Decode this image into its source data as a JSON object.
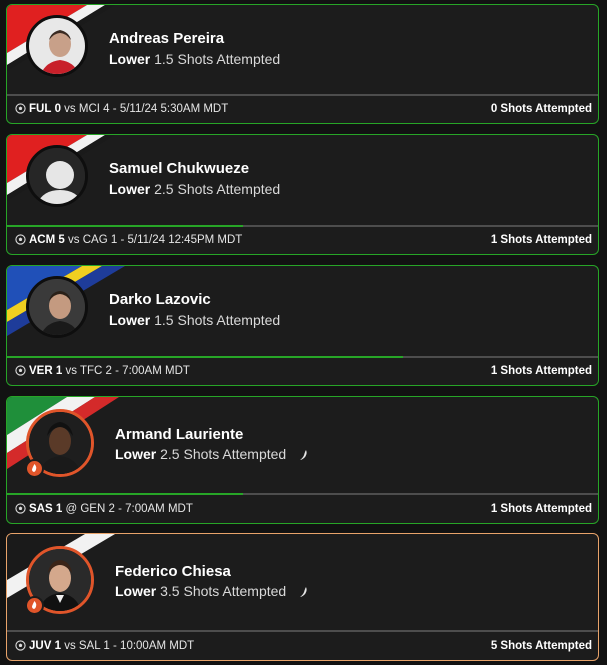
{
  "cards": [
    {
      "name": "Andreas Pereira",
      "direction": "Lower",
      "line": "1.5",
      "stat": "Shots Attempted",
      "team1": "FUL",
      "score1": "0",
      "sep": "vs",
      "team2": "MCI",
      "score2": "4",
      "datetime": "5/11/24 5:30AM MDT",
      "result": "0 Shots Attempted",
      "progress": 0.0
    },
    {
      "name": "Samuel Chukwueze",
      "direction": "Lower",
      "line": "2.5",
      "stat": "Shots Attempted",
      "team1": "ACM",
      "score1": "5",
      "sep": "vs",
      "team2": "CAG",
      "score2": "1",
      "datetime": "5/11/24 12:45PM MDT",
      "result": "1 Shots Attempted",
      "progress": 0.4
    },
    {
      "name": "Darko Lazovic",
      "direction": "Lower",
      "line": "1.5",
      "stat": "Shots Attempted",
      "team1": "VER",
      "score1": "1",
      "sep": "vs",
      "team2": "TFC",
      "score2": "2",
      "datetime": "7:00AM MDT",
      "result": "1 Shots Attempted",
      "progress": 0.67
    },
    {
      "name": "Armand Lauriente",
      "direction": "Lower",
      "line": "2.5",
      "stat": "Shots Attempted",
      "team1": "SAS",
      "score1": "1",
      "sep": "@",
      "team2": "GEN",
      "score2": "2",
      "datetime": "7:00AM MDT",
      "result": "1 Shots Attempted",
      "progress": 0.4
    },
    {
      "name": "Federico Chiesa",
      "direction": "Lower",
      "line": "3.5",
      "stat": "Shots Attempted",
      "team1": "JUV",
      "score1": "1",
      "sep": "vs",
      "team2": "SAL",
      "score2": "1",
      "datetime": "10:00AM MDT",
      "result": "5 Shots Attempted",
      "progress": 0.0
    }
  ],
  "colors": {
    "accent_green": "#27a527",
    "border_orange": "#e8a36a",
    "hot_orange": "#e0552a",
    "card_bg": "#1c1c1c"
  },
  "icons": {
    "ball": "soccer-ball-icon",
    "hot": "chili-pepper-icon",
    "flame": "flame-icon",
    "avatar_placeholder": "user-silhouette-icon"
  }
}
